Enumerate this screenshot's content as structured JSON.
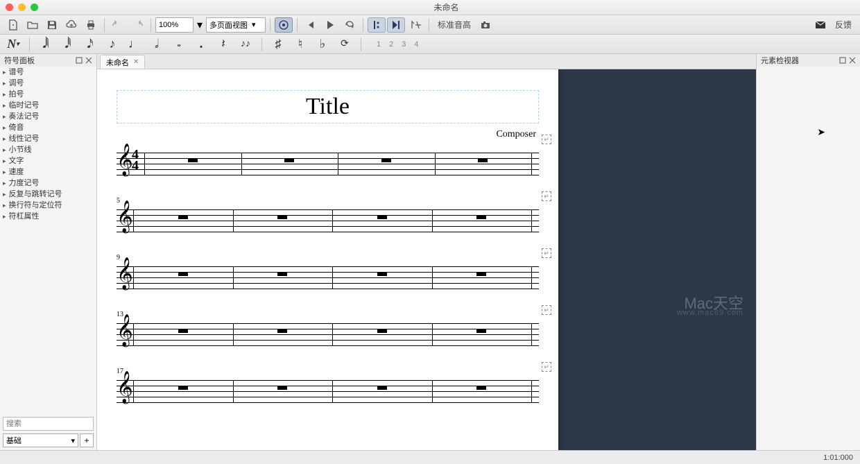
{
  "window": {
    "title": "未命名"
  },
  "toolbar": {
    "zoom": "100%",
    "view_mode": "多页面视图",
    "concert_pitch": "标准音高",
    "feedback": "反馈"
  },
  "notebar": {
    "voices": [
      "1",
      "2",
      "3",
      "4"
    ]
  },
  "palette": {
    "title": "符号面板",
    "items": [
      "谱号",
      "调号",
      "拍号",
      "临时记号",
      "奏法记号",
      "倚音",
      "线性记号",
      "小节线",
      "文字",
      "速度",
      "力度记号",
      "反复与跳转记号",
      "换行符与定位符",
      "符杠属性"
    ],
    "search_placeholder": "搜索",
    "basic_label": "基础"
  },
  "doc": {
    "tab_name": "未命名"
  },
  "score": {
    "title": "Title",
    "composer": "Composer",
    "time_num": "4",
    "time_den": "4",
    "systems": [
      {
        "measure_start": "",
        "first": true
      },
      {
        "measure_start": "5",
        "first": false
      },
      {
        "measure_start": "9",
        "first": false
      },
      {
        "measure_start": "13",
        "first": false
      },
      {
        "measure_start": "17",
        "first": false
      }
    ]
  },
  "inspector": {
    "title": "元素检视器"
  },
  "status": {
    "position": "1:01:000"
  },
  "watermark": {
    "main": "Mac天空",
    "sub": "www.mac69.com"
  }
}
